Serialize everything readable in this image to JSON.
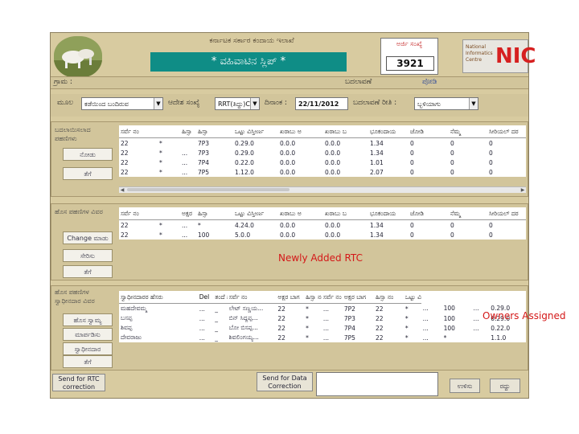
{
  "header": {
    "title": "ಕರ್ನಾಟಕ ಸರ್ಕಾರ ಕಂದಾಯ ಇಲಾಖೆ",
    "banner": "* ವಹಿವಾಟಿನ ಸ್ಲಿಪ್ *",
    "request_label": "ಅರ್ಜಿ ಸಂಖ್ಯೆ",
    "request_number": "3921",
    "nic_small": "National Informatics Centre",
    "nic_logo": "NIC"
  },
  "row1": {
    "village_label": "ಗ್ರಾಮ :",
    "change_label": "ಬದಲಾವಣೆ",
    "change_value": "ಪೋಡಿ"
  },
  "row2": {
    "source_label": "ಮೂಲ",
    "source_value": "ಕಡೆಯಿಂದ ಬಂದಿರುವ",
    "order_label": "ಆದೇಶ ಸಂಖ್ಯೆ",
    "order_value": "RRT(ತಿದ್ದು)C",
    "date_label": "ದಿನಾಂಕ :",
    "date_value": "22/11/2012",
    "method_label": "ಬದಲಾವಣೆ ರೀತಿ :",
    "method_value": "ಬ್ಬಳಿಯಾಗು"
  },
  "sec1": {
    "label": "ಬದಲಾಯಿಸಲಾದ ಪಹಣಿಗಳು",
    "btn1": "ನೋಡು",
    "btn2": "ತೆಗೆ",
    "headers": [
      "ಸರ್ವೆ ನಂ",
      "ಹಿಸ್ಸಾ",
      "ಹಿಸ್ಸಾ",
      "ಒಟ್ಟು ವಿಸ್ತೀರ್ಣ",
      "ಖರಾಬು ಅ",
      "ಖರಾಬು ಬ",
      "ಭೂಕಂದಾಯ",
      "ಜೋಡಿ",
      "ನೆಮ್ಮ",
      "ಸೀರಿಯಲ್ ದರ"
    ],
    "rows": [
      [
        "22",
        "*",
        "",
        "7P3",
        "0.29.0",
        "0.0.0",
        "0.0.0",
        "1.34",
        "0",
        "0",
        "0"
      ],
      [
        "22",
        "*",
        "...",
        "7P3",
        "0.29.0",
        "0.0.0",
        "0.0.0",
        "1.34",
        "0",
        "0",
        "0"
      ],
      [
        "22",
        "*",
        "...",
        "7P4",
        "0.22.0",
        "0.0.0",
        "0.0.0",
        "1.01",
        "0",
        "0",
        "0"
      ],
      [
        "22",
        "*",
        "...",
        "7P5",
        "1.12.0",
        "0.0.0",
        "0.0.0",
        "2.07",
        "0",
        "0",
        "0"
      ]
    ]
  },
  "sec2": {
    "label": "ಹೊಸ ಪಹಣಿಗಳ ವಿವರ",
    "btn1": "Change ಮಾಡು",
    "btn2": "ಸೇರಿಸು",
    "btn3": "ತೆಗೆ",
    "headers": [
      "ಸರ್ವೆ ನಂ",
      "ಅಕ್ಷರ",
      "ಹಿಸ್ಸಾ",
      "ಒಟ್ಟು ವಿಸ್ತೀರ್ಣ",
      "ಖರಾಬು ಅ",
      "ಖರಾಬು ಬ",
      "ಭೂಕಂದಾಯ",
      "ಜೋಡಿ",
      "ನೆಮ್ಮ",
      "ಸೀರಿಯಲ್ ದರ"
    ],
    "rows": [
      [
        "22",
        "*",
        "...",
        "*",
        "4.24.0",
        "0.0.0",
        "0.0.0",
        "1.34",
        "0",
        "0",
        "0"
      ],
      [
        "22",
        "*",
        "...",
        "100",
        "5.0.0",
        "0.0.0",
        "0.0.0",
        "1.34",
        "0",
        "0",
        "0"
      ]
    ],
    "annotation": "Newly Added RTC"
  },
  "sec3": {
    "label": "ಹೊಸ ಪಹಣಿಗಳ ಸ್ವಾಧೀನದಾರ ವಿವರ",
    "btn1": "ಹೊಸ ಸ್ವಾಮ್ಯ",
    "btn2": "ಮಾರ್ಪಡಿಸು",
    "btn3": "ಸ್ವಾಧೀನದಾರ",
    "btn4": "ತೆಗೆ",
    "headers": [
      "ಸ್ವಾಧೀನದಾರರ ಹೆಸರು",
      "Del",
      "ತಂದೆ ಹೆಸರು",
      "ಸರ್ವೆ ನಂ",
      "ಅಕ್ಷರ ಬಾಗ",
      "ಹಿಸ್ಸಾ ನಂ",
      "ಸರ್ವೆ ನಂ",
      "ಅಕ್ಷರ ಬಾಗ",
      "ಹಿಸ್ಸಾ ನಂ",
      "ಒಟ್ಟು ವಿ"
    ],
    "rows": [
      [
        "ಮಹದೇವಮ್ಮ",
        "...",
        "_",
        "ಲೇಟ್ ಸಣ್ಣಯ...",
        "22",
        "*",
        "...",
        "7P2",
        "22",
        "*",
        "...",
        "100",
        "...",
        "0.29.0"
      ],
      [
        "ಬಸಪ್ಪ",
        "...",
        "_",
        "ಬಿನ್ ಸಿದ್ದಪ್ಪ...",
        "22",
        "*",
        "...",
        "7P3",
        "22",
        "*",
        "...",
        "100",
        "...",
        "0.29.0"
      ],
      [
        "ಶಿವಪ್ಪ",
        "...",
        "_",
        "ಬೋ ಬಿಸಪ್ಪ...",
        "22",
        "*",
        "...",
        "7P4",
        "22",
        "*",
        "...",
        "100",
        "...",
        "0.22.0"
      ],
      [
        "ದೇವರಾಜು",
        "...",
        "_",
        "ಶಿವಲಿಂಗಯ್ಯ...",
        "22",
        "*",
        "...",
        "7P5",
        "22",
        "*",
        "...",
        "*",
        "",
        "1.1.0"
      ]
    ],
    "annotation": "Owners Assigned"
  },
  "footer": {
    "send_rtc": "Send for RTC correction",
    "send_data": "Send for Data Correction",
    "save": "ಉಳಿಸು",
    "cancel": "ರದ್ದು"
  }
}
